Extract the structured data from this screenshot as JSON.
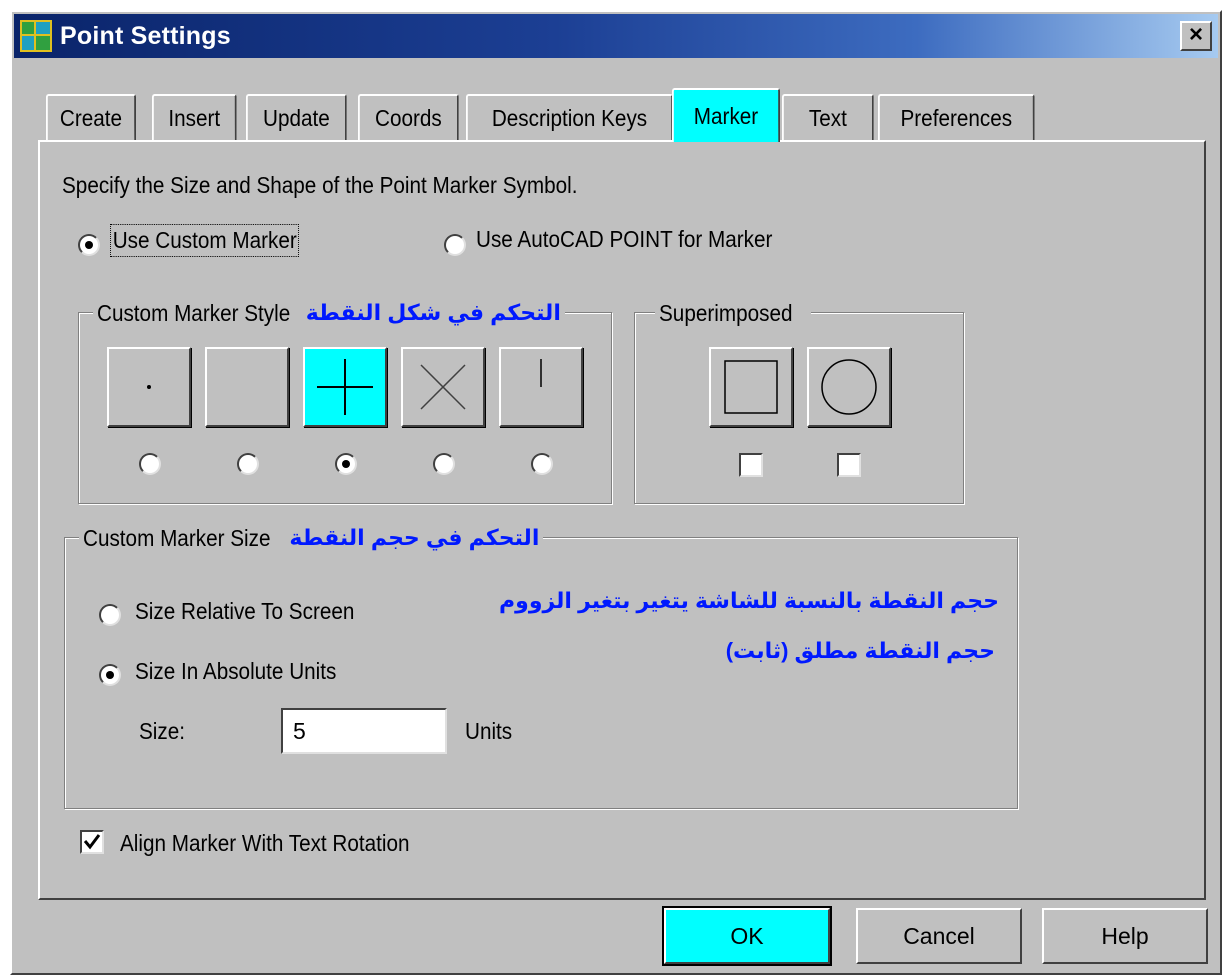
{
  "window": {
    "title": "Point Settings",
    "close_label": "×"
  },
  "tabs": [
    {
      "label": "Create",
      "active": false
    },
    {
      "label": "Insert",
      "active": false
    },
    {
      "label": "Update",
      "active": false
    },
    {
      "label": "Coords",
      "active": false
    },
    {
      "label": "Description Keys",
      "active": false
    },
    {
      "label": "Marker",
      "active": true
    },
    {
      "label": "Text",
      "active": false
    },
    {
      "label": "Preferences",
      "active": false
    }
  ],
  "marker_tab": {
    "instruction": "Specify the Size and Shape of the Point Marker Symbol.",
    "marker_mode": {
      "custom_label": "Use Custom Marker",
      "autocad_label": "Use AutoCAD POINT for Marker",
      "selected": "custom"
    },
    "style_group": {
      "label": "Custom Marker Style",
      "annotation_arabic": "التحكم في شكل النقطة",
      "options": [
        {
          "icon": "dot-marker-icon",
          "selected": false
        },
        {
          "icon": "blank-marker-icon",
          "selected": false
        },
        {
          "icon": "plus-marker-icon",
          "selected": true
        },
        {
          "icon": "x-marker-icon",
          "selected": false
        },
        {
          "icon": "tick-marker-icon",
          "selected": false
        }
      ]
    },
    "superimposed_group": {
      "label": "Superimposed",
      "options": [
        {
          "icon": "square-marker-icon",
          "checked": false
        },
        {
          "icon": "circle-marker-icon",
          "checked": false
        }
      ]
    },
    "size_group": {
      "label": "Custom Marker Size",
      "annotation_arabic": "التحكم في حجم النقطة",
      "relative_label": "Size Relative To Screen",
      "relative_note_arabic": "حجم النقطة بالنسبة للشاشة يتغير بتغير الزووم",
      "absolute_label": "Size In Absolute Units",
      "absolute_note_arabic": "حجم النقطة مطلق (ثابت)",
      "selected": "absolute",
      "size_label": "Size:",
      "size_value": "5",
      "units_label": "Units"
    },
    "align_checkbox": {
      "label": "Align Marker With Text Rotation",
      "checked": true
    }
  },
  "buttons": {
    "ok": "OK",
    "cancel": "Cancel",
    "help": "Help"
  },
  "colors": {
    "title_bar": "#0a246a",
    "highlight": "#00ffff",
    "face": "#c0c0c0",
    "arabic_text": "#0019ff"
  }
}
